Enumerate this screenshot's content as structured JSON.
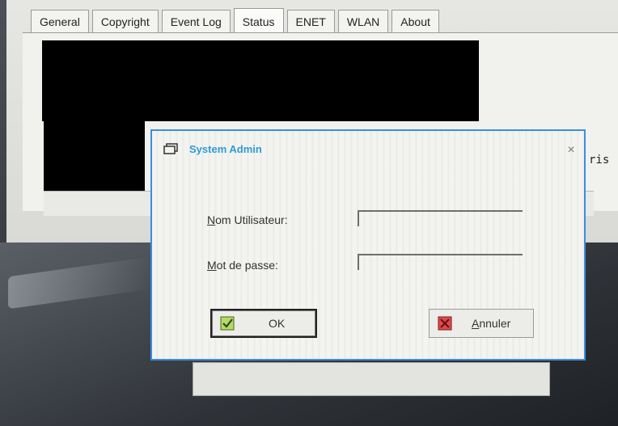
{
  "tabs": [
    {
      "label": "General",
      "active": false
    },
    {
      "label": "Copyright",
      "active": false
    },
    {
      "label": "Event Log",
      "active": false
    },
    {
      "label": "Status",
      "active": true
    },
    {
      "label": "ENET",
      "active": false
    },
    {
      "label": "WLAN",
      "active": false
    },
    {
      "label": "About",
      "active": false
    }
  ],
  "background": {
    "stray_text": "ris"
  },
  "dialog": {
    "title": "System Admin",
    "close_symbol": "×",
    "username_label_first": "N",
    "username_label_rest": "om Utilisateur:",
    "username_value": "",
    "password_label_first": "M",
    "password_label_rest": "ot de passe:",
    "password_value": "",
    "ok_label": "OK",
    "cancel_label_first": "A",
    "cancel_label_rest": "nnuler"
  },
  "icons": {
    "title": "window-icon",
    "ok": "check-icon",
    "cancel": "cross-icon",
    "close": "close-icon"
  },
  "colors": {
    "dialog_border": "#3a8ee0",
    "title_text": "#2f9bd6",
    "ok_icon": "#9acd32",
    "cancel_icon": "#d9343a"
  }
}
